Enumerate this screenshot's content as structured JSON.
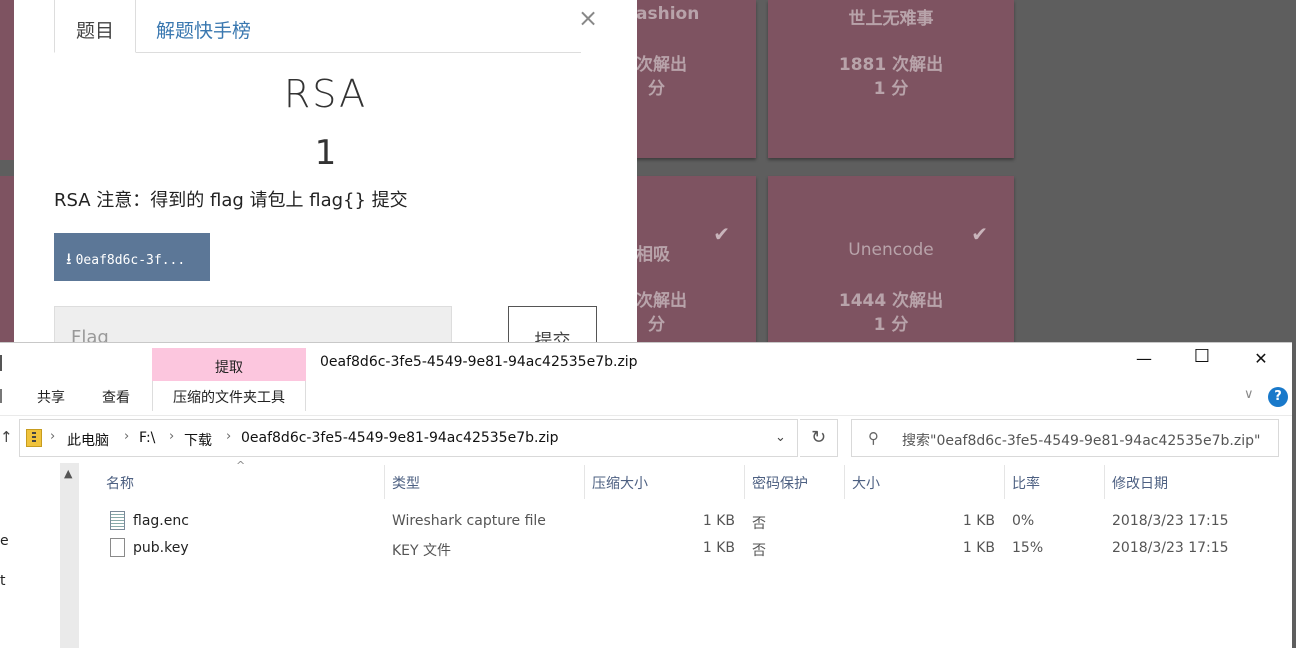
{
  "board": {
    "tiles": [
      {
        "name": "ashion",
        "solves": "次解出",
        "points": "分"
      },
      {
        "name": "世上无难事",
        "solves": "1881 次解出",
        "points": "1 分"
      },
      {
        "name": "相吸",
        "solves": "次解出",
        "points": "分",
        "check": "✔"
      },
      {
        "name": "Unencode",
        "solves": "1444 次解出",
        "points": "1 分",
        "check": "✔"
      }
    ],
    "tile_color": "#7e5361"
  },
  "modal": {
    "tabs": [
      "题目",
      "解题快手榜"
    ],
    "close_glyph": "×",
    "title": "RSA",
    "value": "1",
    "description": "RSA 注意：得到的 flag 请包上 flag{} 提交",
    "download_label": "0eaf8d6c-3f...",
    "flag_placeholder": "Flag",
    "submit_label": "提交"
  },
  "explorer": {
    "context_tab": "提取",
    "window_title": "0eaf8d6c-3fe5-4549-9e81-94ac42535e7b.zip",
    "window_controls": {
      "minimize": "—",
      "maximize": "☐",
      "close": "✕"
    },
    "ribbon_tabs": [
      "共享",
      "查看"
    ],
    "ribbon_context": "压缩的文件夹工具",
    "ribbon_expand": "∨",
    "help": "?",
    "breadcrumbs": [
      "此电脑",
      "F:\\",
      "下载",
      "0eaf8d6c-3fe5-4549-9e81-94ac42535e7b.zip"
    ],
    "search_placeholder": "搜索\"0eaf8d6c-3fe5-4549-9e81-94ac42535e7b.zip\"",
    "nav_fragments": [
      "e",
      "t"
    ],
    "columns": [
      "名称",
      "类型",
      "压缩大小",
      "密码保护",
      "大小",
      "比率",
      "修改日期"
    ],
    "files": [
      {
        "name": "flag.enc",
        "type": "Wireshark capture file",
        "compressed": "1 KB",
        "password": "否",
        "size": "1 KB",
        "ratio": "0%",
        "modified": "2018/3/23 17:15",
        "icon": "capture-file-icon"
      },
      {
        "name": "pub.key",
        "type": "KEY 文件",
        "compressed": "1 KB",
        "password": "否",
        "size": "1 KB",
        "ratio": "15%",
        "modified": "2018/3/23 17:15",
        "icon": "generic-file-icon"
      }
    ],
    "accent_color": "#1979ca",
    "context_tab_color": "#fcc6de"
  }
}
